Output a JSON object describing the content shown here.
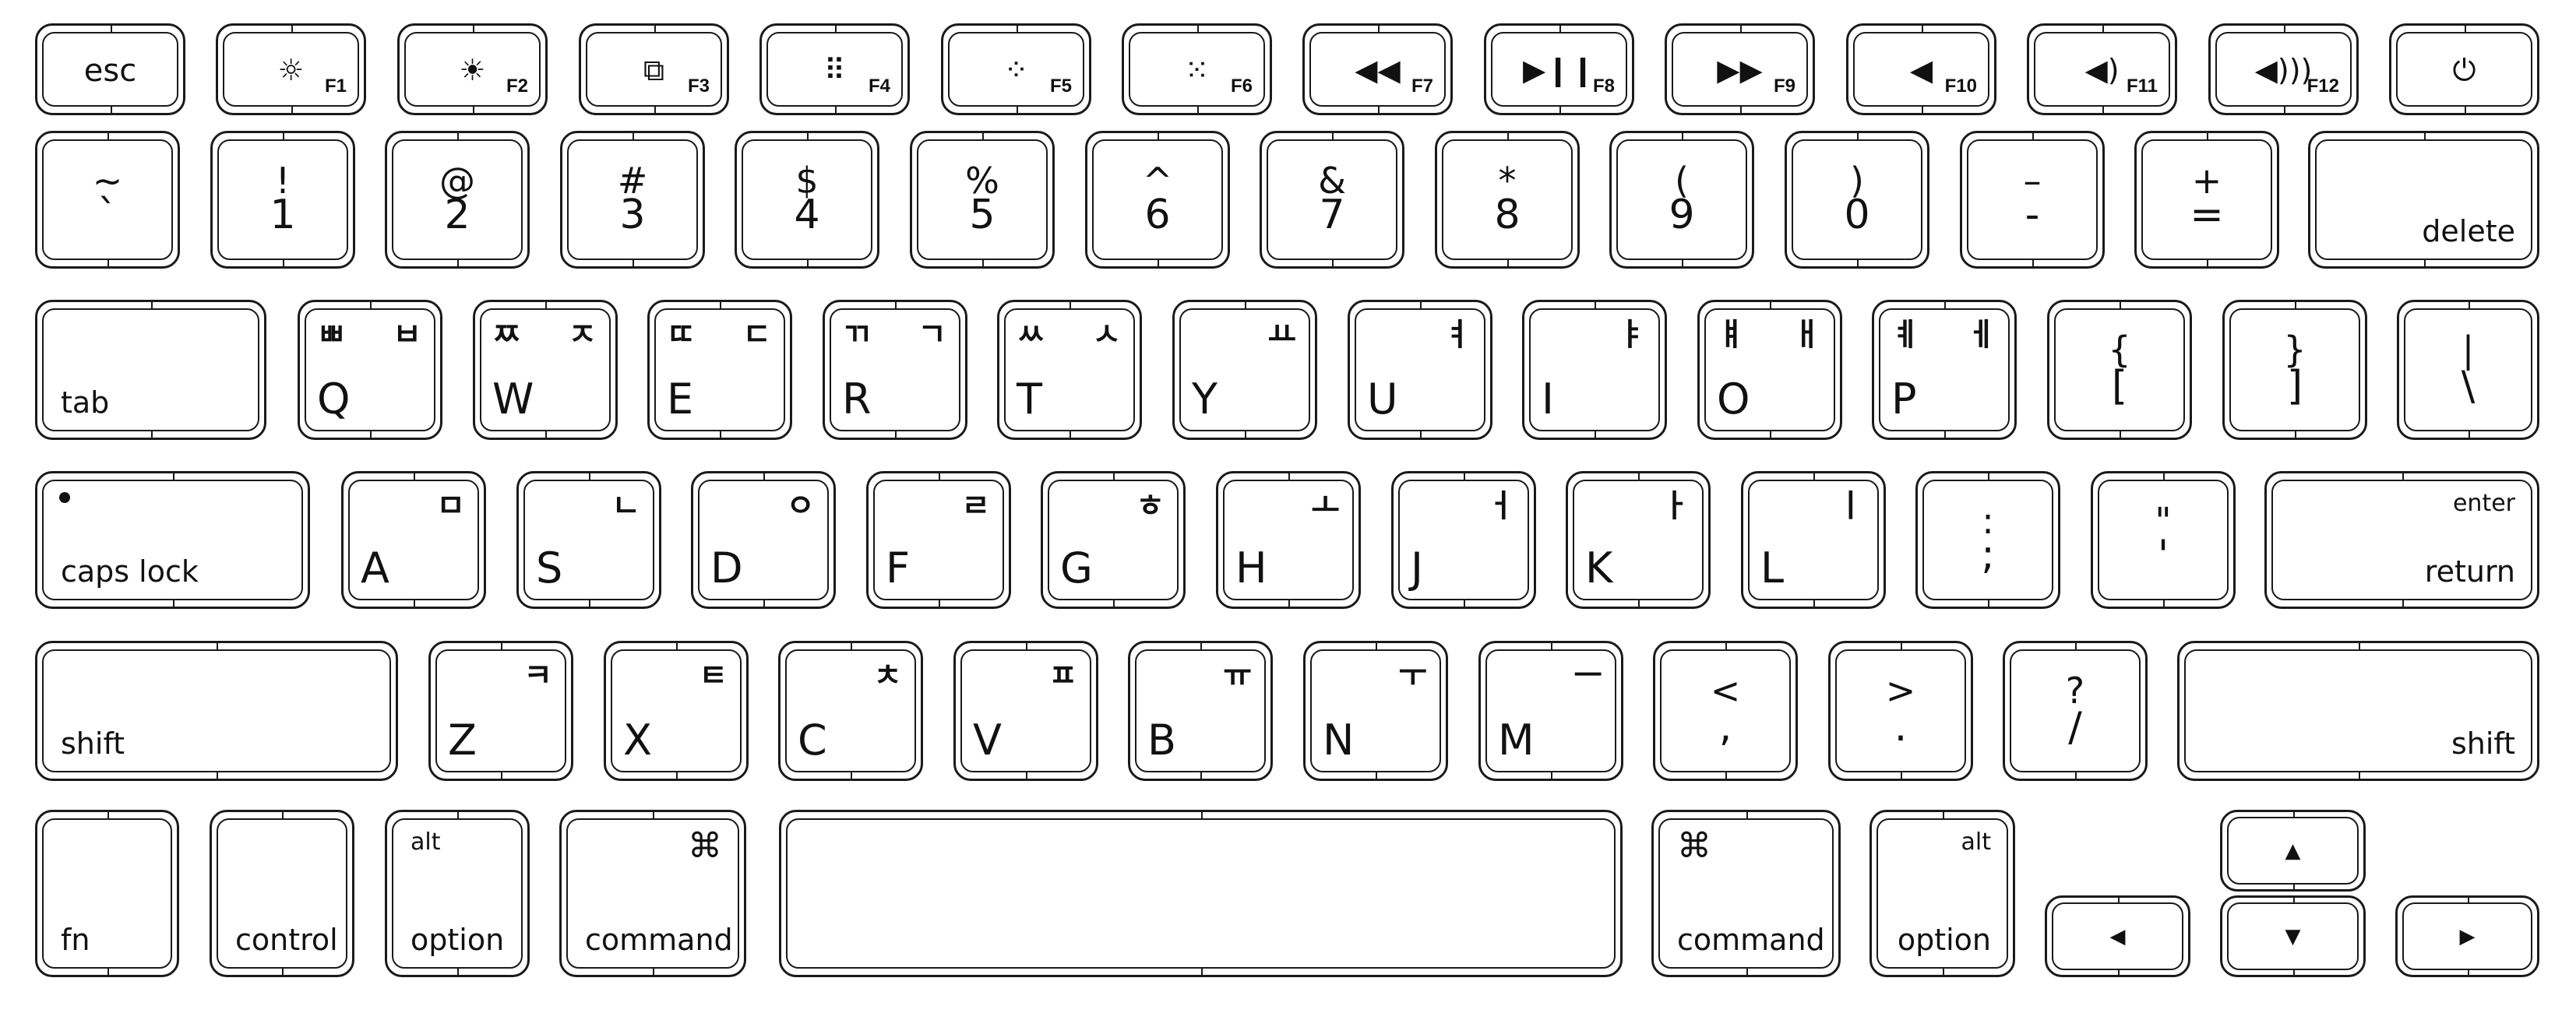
{
  "keyboard": {
    "layout_name": "Korean MacBook keyboard",
    "function_row": [
      {
        "id": "esc",
        "label": "esc"
      },
      {
        "id": "f1",
        "icon": "brightness-down-icon",
        "glyph": "☼",
        "fnum": "F1"
      },
      {
        "id": "f2",
        "icon": "brightness-up-icon",
        "glyph": "☀",
        "fnum": "F2"
      },
      {
        "id": "f3",
        "icon": "mission-control-icon",
        "glyph": "⧉",
        "fnum": "F3"
      },
      {
        "id": "f4",
        "icon": "launchpad-icon",
        "glyph": "⠿",
        "fnum": "F4"
      },
      {
        "id": "f5",
        "icon": "keyboard-backlight-down-icon",
        "glyph": "⁘",
        "fnum": "F5"
      },
      {
        "id": "f6",
        "icon": "keyboard-backlight-up-icon",
        "glyph": "⁙",
        "fnum": "F6"
      },
      {
        "id": "f7",
        "icon": "rewind-icon",
        "glyph": "◀◀",
        "fnum": "F7"
      },
      {
        "id": "f8",
        "icon": "play-pause-icon",
        "glyph": "▶❙❙",
        "fnum": "F8"
      },
      {
        "id": "f9",
        "icon": "fast-forward-icon",
        "glyph": "▶▶",
        "fnum": "F9"
      },
      {
        "id": "f10",
        "icon": "mute-icon",
        "glyph": "◀",
        "fnum": "F10"
      },
      {
        "id": "f11",
        "icon": "volume-down-icon",
        "glyph": "◀)",
        "fnum": "F11"
      },
      {
        "id": "f12",
        "icon": "volume-up-icon",
        "glyph": "◀)))",
        "fnum": "F12"
      },
      {
        "id": "power",
        "icon": "power-icon",
        "glyph": "⏻"
      }
    ],
    "number_row": [
      {
        "id": "backtick",
        "top": "~",
        "bottom": "`"
      },
      {
        "id": "1",
        "top": "!",
        "bottom": "1"
      },
      {
        "id": "2",
        "top": "@",
        "bottom": "2"
      },
      {
        "id": "3",
        "top": "#",
        "bottom": "3"
      },
      {
        "id": "4",
        "top": "$",
        "bottom": "4"
      },
      {
        "id": "5",
        "top": "%",
        "bottom": "5"
      },
      {
        "id": "6",
        "top": "^",
        "bottom": "6"
      },
      {
        "id": "7",
        "top": "&",
        "bottom": "7"
      },
      {
        "id": "8",
        "top": "*",
        "bottom": "8"
      },
      {
        "id": "9",
        "top": "(",
        "bottom": "9"
      },
      {
        "id": "0",
        "top": ")",
        "bottom": "0"
      },
      {
        "id": "minus",
        "top": "–",
        "bottom": "-"
      },
      {
        "id": "equals",
        "top": "+",
        "bottom": "="
      },
      {
        "id": "delete",
        "label": "delete"
      }
    ],
    "qwerty_row": [
      {
        "id": "tab",
        "label": "tab"
      },
      {
        "id": "q",
        "letter": "Q",
        "kr_shift": "ㅃ",
        "kr": "ㅂ"
      },
      {
        "id": "w",
        "letter": "W",
        "kr_shift": "ㅉ",
        "kr": "ㅈ"
      },
      {
        "id": "e",
        "letter": "E",
        "kr_shift": "ㄸ",
        "kr": "ㄷ"
      },
      {
        "id": "r",
        "letter": "R",
        "kr_shift": "ㄲ",
        "kr": "ㄱ"
      },
      {
        "id": "t",
        "letter": "T",
        "kr_shift": "ㅆ",
        "kr": "ㅅ"
      },
      {
        "id": "y",
        "letter": "Y",
        "kr_shift": "",
        "kr": "ㅛ"
      },
      {
        "id": "u",
        "letter": "U",
        "kr_shift": "",
        "kr": "ㅕ"
      },
      {
        "id": "i",
        "letter": "I",
        "kr_shift": "",
        "kr": "ㅑ"
      },
      {
        "id": "o",
        "letter": "O",
        "kr_shift": "ㅒ",
        "kr": "ㅐ"
      },
      {
        "id": "p",
        "letter": "P",
        "kr_shift": "ㅖ",
        "kr": "ㅔ"
      },
      {
        "id": "lbracket",
        "top": "{",
        "bottom": "["
      },
      {
        "id": "rbracket",
        "top": "}",
        "bottom": "]"
      },
      {
        "id": "backslash",
        "top": "|",
        "bottom": "\\"
      }
    ],
    "home_row": [
      {
        "id": "capslock",
        "label": "caps lock"
      },
      {
        "id": "a",
        "letter": "A",
        "kr": "ㅁ"
      },
      {
        "id": "s",
        "letter": "S",
        "kr": "ㄴ"
      },
      {
        "id": "d",
        "letter": "D",
        "kr": "ㅇ"
      },
      {
        "id": "f",
        "letter": "F",
        "kr": "ㄹ"
      },
      {
        "id": "g",
        "letter": "G",
        "kr": "ㅎ"
      },
      {
        "id": "h",
        "letter": "H",
        "kr": "ㅗ"
      },
      {
        "id": "j",
        "letter": "J",
        "kr": "ㅓ"
      },
      {
        "id": "k",
        "letter": "K",
        "kr": "ㅏ"
      },
      {
        "id": "l",
        "letter": "L",
        "kr": "ㅣ"
      },
      {
        "id": "semicolon",
        "top": ":",
        "bottom": ";"
      },
      {
        "id": "quote",
        "top": "\"",
        "bottom": "'"
      },
      {
        "id": "return",
        "top_label": "enter",
        "label": "return"
      }
    ],
    "shift_row": [
      {
        "id": "lshift",
        "label": "shift"
      },
      {
        "id": "z",
        "letter": "Z",
        "kr": "ㅋ"
      },
      {
        "id": "x",
        "letter": "X",
        "kr": "ㅌ"
      },
      {
        "id": "c",
        "letter": "C",
        "kr": "ㅊ"
      },
      {
        "id": "v",
        "letter": "V",
        "kr": "ㅍ"
      },
      {
        "id": "b",
        "letter": "B",
        "kr": "ㅠ"
      },
      {
        "id": "n",
        "letter": "N",
        "kr": "ㅜ"
      },
      {
        "id": "m",
        "letter": "M",
        "kr": "ㅡ"
      },
      {
        "id": "comma",
        "top": "<",
        "bottom": ","
      },
      {
        "id": "period",
        "top": ">",
        "bottom": "."
      },
      {
        "id": "slash",
        "top": "?",
        "bottom": "/"
      },
      {
        "id": "rshift",
        "label": "shift"
      }
    ],
    "bottom_row": {
      "fn": "fn",
      "control": "control",
      "left_option": {
        "top": "alt",
        "label": "option"
      },
      "left_command": {
        "symbol": "⌘",
        "label": "command"
      },
      "space": "",
      "right_command": {
        "symbol": "⌘",
        "label": "command"
      },
      "right_option": {
        "top": "alt",
        "label": "option"
      },
      "arrows": {
        "left": "◀",
        "up": "▲",
        "down": "▼",
        "right": "▶"
      }
    }
  }
}
